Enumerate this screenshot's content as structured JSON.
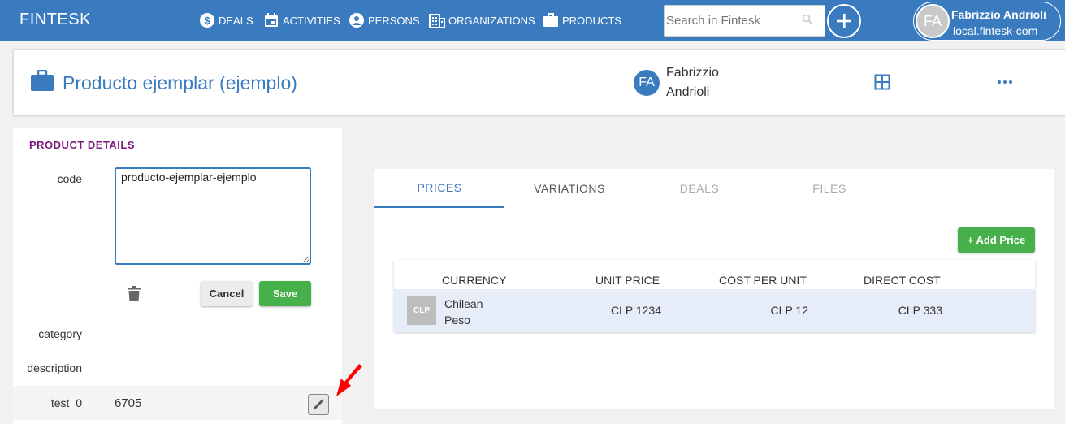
{
  "app": {
    "brand": "FINTESK"
  },
  "nav": [
    {
      "label": "DEALS",
      "icon": "dollar-circle-icon"
    },
    {
      "label": "ACTIVITIES",
      "icon": "calendar-icon"
    },
    {
      "label": "PERSONS",
      "icon": "person-icon"
    },
    {
      "label": "ORGANIZATIONS",
      "icon": "building-icon"
    },
    {
      "label": "PRODUCTS",
      "icon": "briefcase-icon"
    }
  ],
  "search": {
    "placeholder": "Search in Fintesk"
  },
  "user": {
    "initials": "FA",
    "name": "Fabrizzio Andrioli",
    "domain": "local.fintesk-com"
  },
  "product": {
    "title": "Producto ejemplar (ejemplo)",
    "owner_initials": "FA",
    "owner_name": "Fabrizzio Andrioli"
  },
  "details": {
    "title": "PRODUCT DETAILS",
    "code_label": "code",
    "code_value": "producto-ejemplar-ejemplo",
    "cancel_label": "Cancel",
    "save_label": "Save",
    "category_label": "category",
    "description_label": "description",
    "test_label": "test_0",
    "test_value": "6705"
  },
  "tabs": [
    {
      "label": "PRICES",
      "state": "active"
    },
    {
      "label": "VARIATIONS",
      "state": "normal"
    },
    {
      "label": "DEALS",
      "state": "disabled"
    },
    {
      "label": "FILES",
      "state": "disabled"
    }
  ],
  "prices": {
    "add_label": "+ Add Price",
    "headers": [
      "CURRENCY",
      "UNIT PRICE",
      "COST PER UNIT",
      "DIRECT COST"
    ],
    "rows": [
      {
        "badge": "CLP",
        "currency": "Chilean Peso",
        "unit_price": "CLP 1234",
        "cost_per_unit": "CLP 12",
        "direct_cost": "CLP 333"
      }
    ]
  },
  "colors": {
    "primary": "#3a7bc0",
    "success": "#46b04a",
    "section_title": "#7b1a7b",
    "arrow": "#ff0000"
  }
}
